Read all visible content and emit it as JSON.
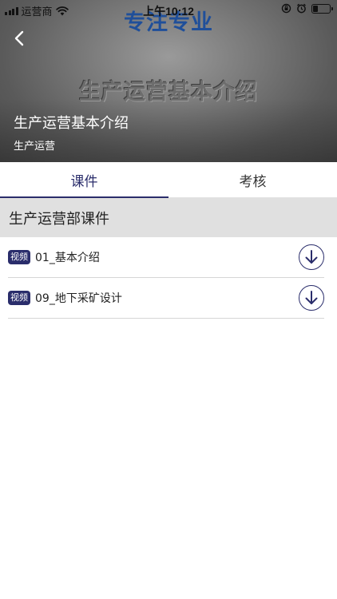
{
  "status_bar": {
    "carrier": "运营商",
    "time": "上午10:12",
    "icons": [
      "signal-icon",
      "wifi-icon",
      "orientation-lock-icon",
      "alarm-icon",
      "battery-icon"
    ]
  },
  "hero": {
    "brand_text": "专注专业",
    "watermark_text": "生产运营基本介绍",
    "title": "生产运营基本介绍",
    "subtitle": "生产运营",
    "back_icon": "chevron-left-icon"
  },
  "tabs": [
    {
      "label": "课件",
      "active": true
    },
    {
      "label": "考核",
      "active": false
    }
  ],
  "section": {
    "title": "生产运营部课件"
  },
  "items": [
    {
      "badge": "视频",
      "title": "01_基本介绍",
      "action_icon": "download-icon"
    },
    {
      "badge": "视频",
      "title": "09_地下采矿设计",
      "action_icon": "download-icon"
    }
  ],
  "colors": {
    "accent": "#2a2d6b",
    "brand": "#1f4f9a",
    "section_bg": "#e0e0e0"
  }
}
